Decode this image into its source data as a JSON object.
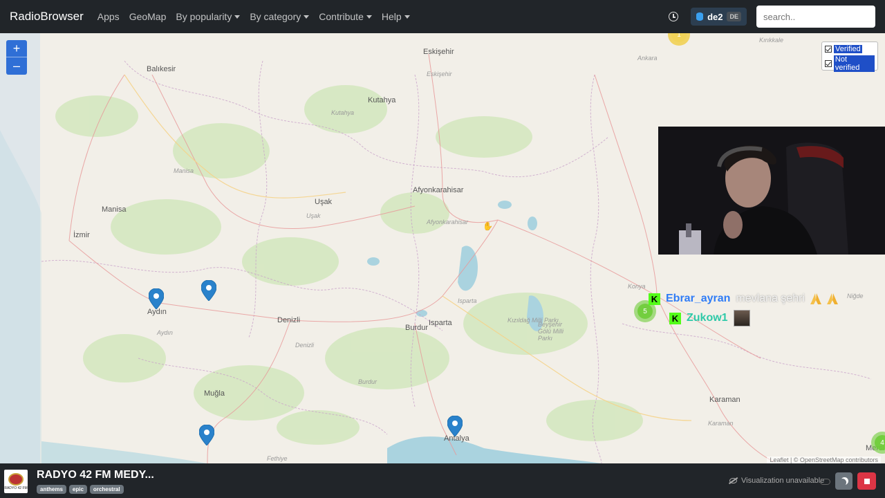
{
  "navbar": {
    "brand": "RadioBrowser",
    "items": [
      {
        "label": "Apps",
        "dropdown": false
      },
      {
        "label": "GeoMap",
        "dropdown": false
      },
      {
        "label": "By popularity",
        "dropdown": true
      },
      {
        "label": "By category",
        "dropdown": true
      },
      {
        "label": "Contribute",
        "dropdown": true
      },
      {
        "label": "Help",
        "dropdown": true
      }
    ],
    "server": {
      "name": "de2",
      "badge": "DE"
    },
    "search_placeholder": "search.."
  },
  "map": {
    "zoom_in": "+",
    "zoom_out": "–",
    "filter": {
      "verified": "Verified",
      "not_verified": "Not verified"
    },
    "labels": {
      "eskisehir": "Eskişehir",
      "eskisehir_minor": "Eskişehir",
      "ankara": "Ankara",
      "kirikkale": "Kırıkkale",
      "balikesir": "Balıkesir",
      "kutahya": "Kutahya",
      "kutahya_minor": "Kutahya",
      "manisa": "Manisa",
      "manisa_minor": "Manisa",
      "usak": "Uşak",
      "usak_minor": "Uşak",
      "afyon": "Afyonkarahisar",
      "afyon_minor": "Afyonkarahisar",
      "izmir": "İzmir",
      "aydin": "Aydın",
      "aydin_minor": "Aydın",
      "denizli": "Denizli",
      "denizli_minor": "Denizli",
      "isparta": "Isparta",
      "isparta_minor": "Isparta",
      "burdur": "Burdur",
      "burdur_minor": "Burdur",
      "konya": "Konya",
      "nigde": "Niğde",
      "karaman": "Karaman",
      "karaman_minor": "Karaman",
      "mugla": "Muğla",
      "antalya": "Antalya",
      "mersin": "Mersi",
      "beysehir": "Beyşehir Gölü Milli Parkı",
      "kizildag": "Kızıldağ Milli Parkı",
      "fethiye": "Fethiye"
    },
    "clusters": {
      "konya": "5",
      "edge": "4",
      "top": "1"
    },
    "attribution": "Leaflet | © OpenStreetMap contributors"
  },
  "chat": [
    {
      "user": "Ebrar_ayran",
      "message": "mevlana şehri",
      "user_color": "#2f7cf6"
    },
    {
      "user": "Zukow1",
      "message": "",
      "user_color": "#2ec9a8"
    }
  ],
  "player": {
    "station_name": "RADYO 42 FM MEDY...",
    "tags": [
      "anthems",
      "epic",
      "orchestral"
    ],
    "logo_text": "RADYO 42 FM",
    "visualization": "Visualization unavailable"
  }
}
